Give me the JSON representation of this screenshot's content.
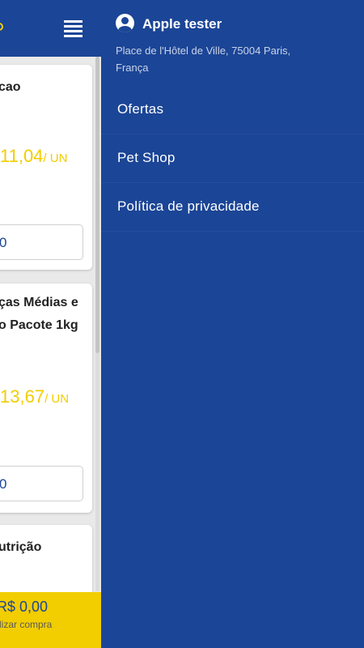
{
  "main": {
    "cards": [
      {
        "title": "cao",
        "price": "11,04",
        "unit": "/ UN",
        "quantity": "0"
      },
      {
        "title_lines": [
          "ças Médias e",
          "o Pacote 1kg"
        ],
        "price": "13,67",
        "unit": "/ UN",
        "quantity": "0"
      },
      {
        "title": "utrição"
      }
    ],
    "cart": {
      "total": "R$ 0,00",
      "hint": "lizar compra"
    }
  },
  "drawer": {
    "user": {
      "name": "Apple tester",
      "address": "Place de l'Hôtel de Ville, 75004 Paris, França"
    },
    "items": [
      {
        "label": "Ofertas"
      },
      {
        "label": "Pet Shop"
      },
      {
        "label": "Política de privacidade"
      }
    ]
  },
  "colors": {
    "primary": "#1b4596",
    "accent": "#f2cd00"
  },
  "icons": {
    "menu": "hamburger-menu-icon",
    "user": "account-circle-icon"
  }
}
